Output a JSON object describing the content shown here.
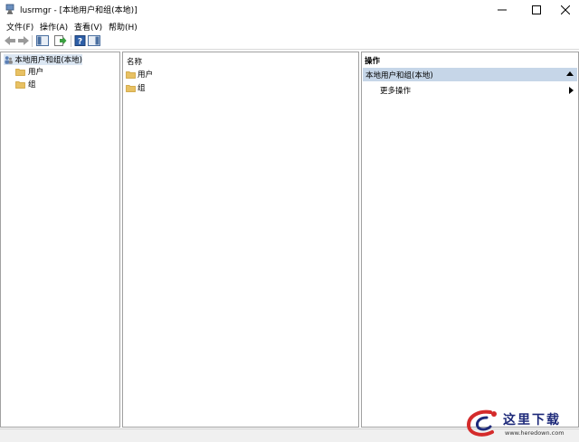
{
  "window": {
    "title": "lusrmgr - [本地用户和组(本地)]",
    "minimize_glyph": "—",
    "maximize_glyph": "☐",
    "close_glyph": "✕"
  },
  "menu": {
    "items": [
      "文件(F)",
      "操作(A)",
      "查看(V)",
      "帮助(H)"
    ]
  },
  "toolbar": {
    "icons": [
      "back-icon",
      "forward-icon",
      "show-hide-tree-icon",
      "export-list-icon",
      "help-icon",
      "show-hide-action-pane-icon"
    ]
  },
  "tree": {
    "root": "本地用户和组(本地)",
    "children": [
      "用户",
      "组"
    ]
  },
  "list": {
    "column_header": "名称",
    "rows": [
      "用户",
      "组"
    ]
  },
  "actions": {
    "title": "操作",
    "section": "本地用户和组(本地)",
    "items": [
      "更多操作"
    ]
  },
  "watermark": {
    "text": "这里下载",
    "url": "www.heredown.com"
  },
  "colors": {
    "selection": "#dbe6f2",
    "section_header": "#c6d6e8",
    "folder": "#e8c163",
    "accent": "#1e2a7a"
  }
}
